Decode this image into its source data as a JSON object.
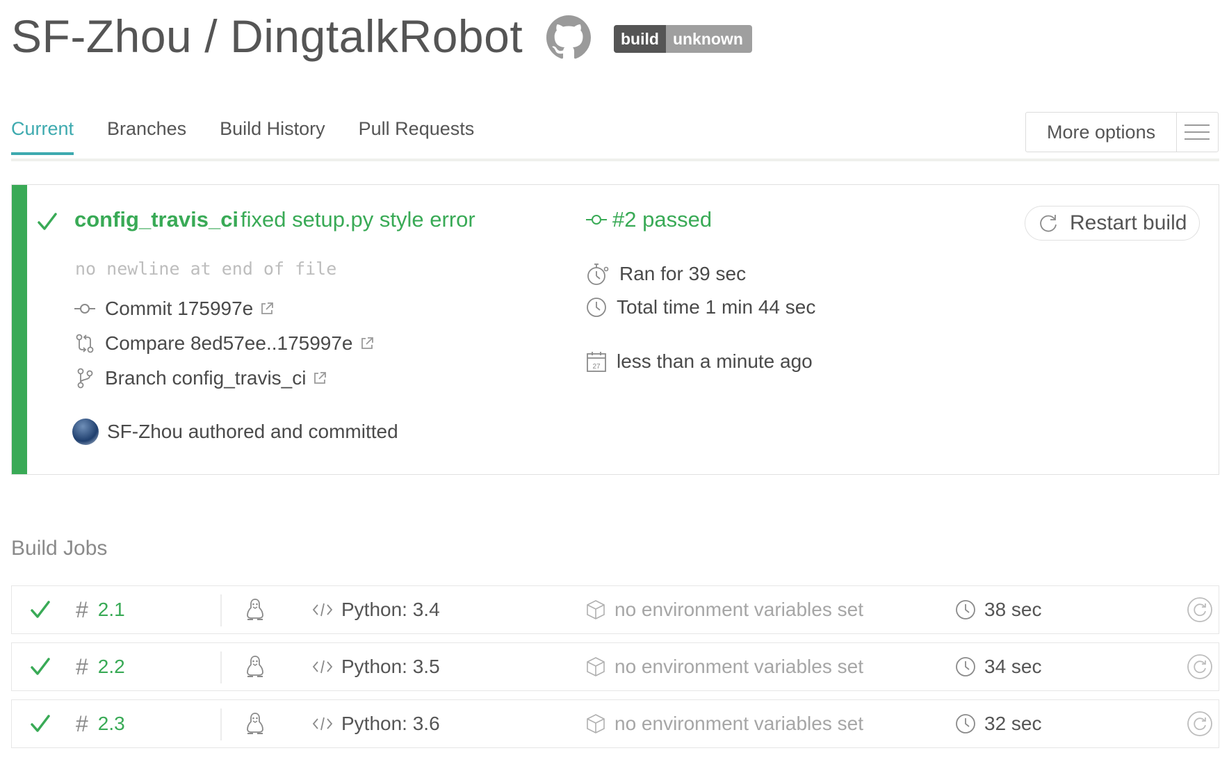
{
  "header": {
    "owner": "SF-Zhou",
    "separator": "/",
    "repo": "DingtalkRobot",
    "badge": {
      "left": "build",
      "right": "unknown"
    }
  },
  "tabs": [
    {
      "label": "Current",
      "active": true
    },
    {
      "label": "Branches",
      "active": false
    },
    {
      "label": "Build History",
      "active": false
    },
    {
      "label": "Pull Requests",
      "active": false
    }
  ],
  "more_options": {
    "label": "More options"
  },
  "build": {
    "branch": "config_travis_ci",
    "message": "fixed setup.py style error",
    "description": "no newline at end of file",
    "commit": "Commit 175997e",
    "compare": "Compare 8ed57ee..175997e",
    "branch_link": "Branch config_travis_ci",
    "author": "SF-Zhou authored and committed",
    "status": "#2 passed",
    "ran_for": "Ran for 39 sec",
    "total_time": "Total time 1 min 44 sec",
    "finished": "less than a minute ago",
    "calendar_day": "27",
    "restart_label": "Restart build",
    "status_color": "#39aa56"
  },
  "jobs": {
    "title": "Build Jobs",
    "rows": [
      {
        "number": "2.1",
        "language": "Python: 3.4",
        "env": "no environment variables set",
        "duration": "38 sec"
      },
      {
        "number": "2.2",
        "language": "Python: 3.5",
        "env": "no environment variables set",
        "duration": "34 sec"
      },
      {
        "number": "2.3",
        "language": "Python: 3.6",
        "env": "no environment variables set",
        "duration": "32 sec"
      }
    ]
  },
  "icons": {
    "header": "github-icon",
    "menu": "hamburger-menu-icon",
    "passed": "checkmark-icon",
    "commit": "commit-icon",
    "compare": "compare-icon",
    "branch": "branch-icon",
    "external": "external-link-icon",
    "stopwatch": "stopwatch-icon",
    "clock": "clock-icon",
    "calendar": "calendar-icon",
    "restart": "restart-icon",
    "hash": "hash-icon",
    "os": "linux-tux-icon",
    "code": "code-icon",
    "env": "package-box-icon"
  }
}
